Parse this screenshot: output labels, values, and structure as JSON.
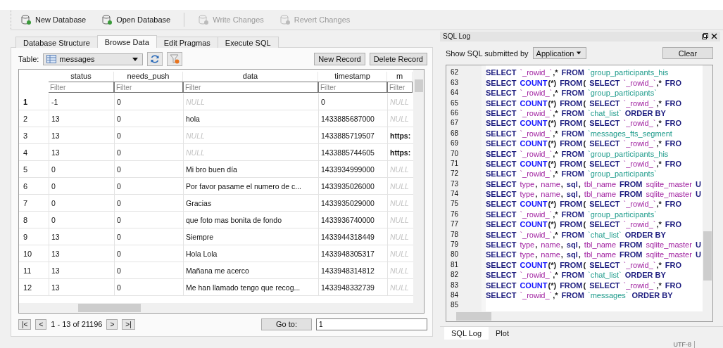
{
  "toolbar": [
    {
      "label": "New Database",
      "disabled": false,
      "kind": "new"
    },
    {
      "label": "Open Database",
      "disabled": false,
      "kind": "open"
    },
    {
      "label": "Write Changes",
      "disabled": true,
      "kind": "write"
    },
    {
      "label": "Revert Changes",
      "disabled": true,
      "kind": "revert"
    }
  ],
  "tabs": [
    {
      "label": "Database Structure",
      "selected": false
    },
    {
      "label": "Browse Data",
      "selected": true
    },
    {
      "label": "Edit Pragmas",
      "selected": false
    },
    {
      "label": "Execute SQL",
      "selected": false
    }
  ],
  "browse": {
    "table_label": "Table:",
    "table": "messages",
    "buttons": [
      "New Record",
      "Delete Record"
    ],
    "columns": [
      {
        "name": "status",
        "filter_placeholder": "Filter"
      },
      {
        "name": "needs_push",
        "filter_placeholder": "Filter"
      },
      {
        "name": "data",
        "filter_placeholder": "Filter"
      },
      {
        "name": "timestamp",
        "filter_placeholder": "Filter"
      },
      {
        "name": "m",
        "filter_placeholder": "Filter"
      }
    ],
    "rows": [
      {
        "number": "1",
        "current": true,
        "cells": [
          {
            "text": "-1",
            "null": false
          },
          {
            "text": "0",
            "null": false
          },
          {
            "text": "NULL",
            "null": true
          },
          {
            "text": "0",
            "null": false
          },
          {
            "text": "NULL",
            "null": true
          }
        ]
      },
      {
        "number": "2",
        "current": false,
        "cells": [
          {
            "text": "13",
            "null": false
          },
          {
            "text": "0",
            "null": false
          },
          {
            "text": "hola",
            "null": false
          },
          {
            "text": "1433885687000",
            "null": false
          },
          {
            "text": "NULL",
            "null": true
          }
        ]
      },
      {
        "number": "3",
        "current": false,
        "cells": [
          {
            "text": "13",
            "null": false
          },
          {
            "text": "0",
            "null": false
          },
          {
            "text": "NULL",
            "null": true
          },
          {
            "text": "1433885719507",
            "null": false
          },
          {
            "text": "https:",
            "null": false
          }
        ]
      },
      {
        "number": "4",
        "current": false,
        "cells": [
          {
            "text": "13",
            "null": false
          },
          {
            "text": "0",
            "null": false
          },
          {
            "text": "NULL",
            "null": true
          },
          {
            "text": "1433885744605",
            "null": false
          },
          {
            "text": "https:",
            "null": false
          }
        ]
      },
      {
        "number": "5",
        "current": false,
        "cells": [
          {
            "text": "0",
            "null": false
          },
          {
            "text": "0",
            "null": false
          },
          {
            "text": "Mi bro buen día",
            "null": false
          },
          {
            "text": "1433934999000",
            "null": false
          },
          {
            "text": "NULL",
            "null": true
          }
        ]
      },
      {
        "number": "6",
        "current": false,
        "cells": [
          {
            "text": "0",
            "null": false
          },
          {
            "text": "0",
            "null": false
          },
          {
            "text": "Por favor pasame el numero de c...",
            "null": false
          },
          {
            "text": "1433935026000",
            "null": false
          },
          {
            "text": "NULL",
            "null": true
          }
        ]
      },
      {
        "number": "7",
        "current": false,
        "cells": [
          {
            "text": "0",
            "null": false
          },
          {
            "text": "0",
            "null": false
          },
          {
            "text": "Gracias",
            "null": false
          },
          {
            "text": "1433935029000",
            "null": false
          },
          {
            "text": "NULL",
            "null": true
          }
        ]
      },
      {
        "number": "8",
        "current": false,
        "cells": [
          {
            "text": "0",
            "null": false
          },
          {
            "text": "0",
            "null": false
          },
          {
            "text": "que foto mas bonita de fondo",
            "null": false
          },
          {
            "text": "1433936740000",
            "null": false
          },
          {
            "text": "NULL",
            "null": true
          }
        ]
      },
      {
        "number": "9",
        "current": false,
        "cells": [
          {
            "text": "13",
            "null": false
          },
          {
            "text": "0",
            "null": false
          },
          {
            "text": "Siempre",
            "null": false
          },
          {
            "text": "1433944318449",
            "null": false
          },
          {
            "text": "NULL",
            "null": true
          }
        ]
      },
      {
        "number": "10",
        "current": false,
        "cells": [
          {
            "text": "13",
            "null": false
          },
          {
            "text": "0",
            "null": false
          },
          {
            "text": "Hola Lola",
            "null": false
          },
          {
            "text": "1433948305317",
            "null": false
          },
          {
            "text": "NULL",
            "null": true
          }
        ]
      },
      {
        "number": "11",
        "current": false,
        "cells": [
          {
            "text": "13",
            "null": false
          },
          {
            "text": "0",
            "null": false
          },
          {
            "text": "Mañana me acerco",
            "null": false
          },
          {
            "text": "1433948314812",
            "null": false
          },
          {
            "text": "NULL",
            "null": true
          }
        ]
      },
      {
        "number": "12",
        "current": false,
        "cells": [
          {
            "text": "13",
            "null": false
          },
          {
            "text": "0",
            "null": false
          },
          {
            "text": "Me han llamado tengo que recog...",
            "null": false
          },
          {
            "text": "1433948332739",
            "null": false
          },
          {
            "text": "NULL",
            "null": true
          }
        ]
      }
    ],
    "pager": {
      "first": "|<",
      "prev": "<",
      "range": "1 - 13 of 21196",
      "next": ">",
      "last": ">|",
      "goto_label": "Go to:",
      "goto_value": "1"
    }
  },
  "sql_log": {
    "title": "SQL Log",
    "filter_label": "Show SQL submitted by",
    "filter_value": "Application",
    "clear": "Clear",
    "lines": [
      {
        "number": "62",
        "tokens": [
          {
            "kind": "k",
            "text": "SELECT"
          },
          {
            "kind": "i",
            "text": "`_rowid_`"
          },
          {
            "kind": "p",
            "text": ",*"
          },
          {
            "kind": "k",
            "text": "FROM"
          },
          {
            "kind": "t",
            "text": "`group_participants_his"
          }
        ]
      },
      {
        "number": "63",
        "tokens": [
          {
            "kind": "k",
            "text": "SELECT"
          },
          {
            "kind": "f",
            "text": "COUNT"
          },
          {
            "kind": "p",
            "text": "(*)"
          },
          {
            "kind": "k",
            "text": "FROM"
          },
          {
            "kind": "p",
            "text": "("
          },
          {
            "kind": "k",
            "text": "SELECT"
          },
          {
            "kind": "i",
            "text": "`_rowid_`"
          },
          {
            "kind": "p",
            "text": ",*"
          },
          {
            "kind": "k",
            "text": "FRO"
          }
        ]
      },
      {
        "number": "64",
        "tokens": [
          {
            "kind": "k",
            "text": "SELECT"
          },
          {
            "kind": "i",
            "text": "`_rowid_`"
          },
          {
            "kind": "p",
            "text": ",*"
          },
          {
            "kind": "k",
            "text": "FROM"
          },
          {
            "kind": "t",
            "text": "`group_participants`"
          }
        ]
      },
      {
        "number": "65",
        "tokens": [
          {
            "kind": "k",
            "text": "SELECT"
          },
          {
            "kind": "f",
            "text": "COUNT"
          },
          {
            "kind": "p",
            "text": "(*)"
          },
          {
            "kind": "k",
            "text": "FROM"
          },
          {
            "kind": "p",
            "text": "("
          },
          {
            "kind": "k",
            "text": "SELECT"
          },
          {
            "kind": "i",
            "text": "`_rowid_`"
          },
          {
            "kind": "p",
            "text": ",*"
          },
          {
            "kind": "k",
            "text": "FRO"
          }
        ]
      },
      {
        "number": "66",
        "tokens": [
          {
            "kind": "k",
            "text": "SELECT"
          },
          {
            "kind": "i",
            "text": "`_rowid_`"
          },
          {
            "kind": "p",
            "text": ",*"
          },
          {
            "kind": "k",
            "text": "FROM"
          },
          {
            "kind": "t",
            "text": "`chat_list`"
          },
          {
            "kind": "k",
            "text": "ORDER BY"
          }
        ]
      },
      {
        "number": "67",
        "tokens": [
          {
            "kind": "k",
            "text": "SELECT"
          },
          {
            "kind": "f",
            "text": "COUNT"
          },
          {
            "kind": "p",
            "text": "(*)"
          },
          {
            "kind": "k",
            "text": "FROM"
          },
          {
            "kind": "p",
            "text": "("
          },
          {
            "kind": "k",
            "text": "SELECT"
          },
          {
            "kind": "i",
            "text": "`_rowid_`"
          },
          {
            "kind": "p",
            "text": ",*"
          },
          {
            "kind": "k",
            "text": "FRO"
          }
        ]
      },
      {
        "number": "68",
        "tokens": [
          {
            "kind": "k",
            "text": "SELECT"
          },
          {
            "kind": "i",
            "text": "`_rowid_`"
          },
          {
            "kind": "p",
            "text": ",*"
          },
          {
            "kind": "k",
            "text": "FROM"
          },
          {
            "kind": "t",
            "text": "`messages_fts_segment"
          }
        ]
      },
      {
        "number": "69",
        "tokens": [
          {
            "kind": "k",
            "text": "SELECT"
          },
          {
            "kind": "f",
            "text": "COUNT"
          },
          {
            "kind": "p",
            "text": "(*)"
          },
          {
            "kind": "k",
            "text": "FROM"
          },
          {
            "kind": "p",
            "text": "("
          },
          {
            "kind": "k",
            "text": "SELECT"
          },
          {
            "kind": "i",
            "text": "`_rowid_`"
          },
          {
            "kind": "p",
            "text": ",*"
          },
          {
            "kind": "k",
            "text": "FRO"
          }
        ]
      },
      {
        "number": "70",
        "tokens": [
          {
            "kind": "k",
            "text": "SELECT"
          },
          {
            "kind": "i",
            "text": "`_rowid_`"
          },
          {
            "kind": "p",
            "text": ",*"
          },
          {
            "kind": "k",
            "text": "FROM"
          },
          {
            "kind": "t",
            "text": "`group_participants_his"
          }
        ]
      },
      {
        "number": "71",
        "tokens": [
          {
            "kind": "k",
            "text": "SELECT"
          },
          {
            "kind": "f",
            "text": "COUNT"
          },
          {
            "kind": "p",
            "text": "(*)"
          },
          {
            "kind": "k",
            "text": "FROM"
          },
          {
            "kind": "p",
            "text": "("
          },
          {
            "kind": "k",
            "text": "SELECT"
          },
          {
            "kind": "i",
            "text": "`_rowid_`"
          },
          {
            "kind": "p",
            "text": ",*"
          },
          {
            "kind": "k",
            "text": "FRO"
          }
        ]
      },
      {
        "number": "72",
        "tokens": [
          {
            "kind": "k",
            "text": "SELECT"
          },
          {
            "kind": "i",
            "text": "`_rowid_`"
          },
          {
            "kind": "p",
            "text": ",*"
          },
          {
            "kind": "k",
            "text": "FROM"
          },
          {
            "kind": "t",
            "text": "`group_participants`"
          }
        ]
      },
      {
        "number": "73",
        "tokens": [
          {
            "kind": "k",
            "text": "SELECT"
          },
          {
            "kind": "i",
            "text": "type"
          },
          {
            "kind": "p",
            "text": ","
          },
          {
            "kind": "i",
            "text": "name"
          },
          {
            "kind": "p",
            "text": ","
          },
          {
            "kind": "k",
            "text": "sql"
          },
          {
            "kind": "p",
            "text": ","
          },
          {
            "kind": "i",
            "text": "tbl_name"
          },
          {
            "kind": "k",
            "text": "FROM"
          },
          {
            "kind": "i",
            "text": "sqlite_master"
          },
          {
            "kind": "k",
            "text": "U"
          }
        ]
      },
      {
        "number": "74",
        "tokens": [
          {
            "kind": "k",
            "text": "SELECT"
          },
          {
            "kind": "i",
            "text": "type"
          },
          {
            "kind": "p",
            "text": ","
          },
          {
            "kind": "i",
            "text": "name"
          },
          {
            "kind": "p",
            "text": ","
          },
          {
            "kind": "k",
            "text": "sql"
          },
          {
            "kind": "p",
            "text": ","
          },
          {
            "kind": "i",
            "text": "tbl_name"
          },
          {
            "kind": "k",
            "text": "FROM"
          },
          {
            "kind": "i",
            "text": "sqlite_master"
          },
          {
            "kind": "k",
            "text": "U"
          }
        ]
      },
      {
        "number": "75",
        "tokens": [
          {
            "kind": "k",
            "text": "SELECT"
          },
          {
            "kind": "f",
            "text": "COUNT"
          },
          {
            "kind": "p",
            "text": "(*)"
          },
          {
            "kind": "k",
            "text": "FROM"
          },
          {
            "kind": "p",
            "text": "("
          },
          {
            "kind": "k",
            "text": "SELECT"
          },
          {
            "kind": "i",
            "text": "`_rowid_`"
          },
          {
            "kind": "p",
            "text": ",*"
          },
          {
            "kind": "k",
            "text": "FRO"
          }
        ]
      },
      {
        "number": "76",
        "tokens": [
          {
            "kind": "k",
            "text": "SELECT"
          },
          {
            "kind": "i",
            "text": "`_rowid_`"
          },
          {
            "kind": "p",
            "text": ",*"
          },
          {
            "kind": "k",
            "text": "FROM"
          },
          {
            "kind": "t",
            "text": "`group_participants`"
          }
        ]
      },
      {
        "number": "77",
        "tokens": [
          {
            "kind": "k",
            "text": "SELECT"
          },
          {
            "kind": "f",
            "text": "COUNT"
          },
          {
            "kind": "p",
            "text": "(*)"
          },
          {
            "kind": "k",
            "text": "FROM"
          },
          {
            "kind": "p",
            "text": "("
          },
          {
            "kind": "k",
            "text": "SELECT"
          },
          {
            "kind": "i",
            "text": "`_rowid_`"
          },
          {
            "kind": "p",
            "text": ",*"
          },
          {
            "kind": "k",
            "text": "FRO"
          }
        ]
      },
      {
        "number": "78",
        "tokens": [
          {
            "kind": "k",
            "text": "SELECT"
          },
          {
            "kind": "i",
            "text": "`_rowid_`"
          },
          {
            "kind": "p",
            "text": ",*"
          },
          {
            "kind": "k",
            "text": "FROM"
          },
          {
            "kind": "t",
            "text": "`chat_list`"
          },
          {
            "kind": "k",
            "text": "ORDER BY"
          }
        ]
      },
      {
        "number": "79",
        "tokens": [
          {
            "kind": "k",
            "text": "SELECT"
          },
          {
            "kind": "i",
            "text": "type"
          },
          {
            "kind": "p",
            "text": ","
          },
          {
            "kind": "i",
            "text": "name"
          },
          {
            "kind": "p",
            "text": ","
          },
          {
            "kind": "k",
            "text": "sql"
          },
          {
            "kind": "p",
            "text": ","
          },
          {
            "kind": "i",
            "text": "tbl_name"
          },
          {
            "kind": "k",
            "text": "FROM"
          },
          {
            "kind": "i",
            "text": "sqlite_master"
          },
          {
            "kind": "k",
            "text": "U"
          }
        ]
      },
      {
        "number": "80",
        "tokens": [
          {
            "kind": "k",
            "text": "SELECT"
          },
          {
            "kind": "i",
            "text": "type"
          },
          {
            "kind": "p",
            "text": ","
          },
          {
            "kind": "i",
            "text": "name"
          },
          {
            "kind": "p",
            "text": ","
          },
          {
            "kind": "k",
            "text": "sql"
          },
          {
            "kind": "p",
            "text": ","
          },
          {
            "kind": "i",
            "text": "tbl_name"
          },
          {
            "kind": "k",
            "text": "FROM"
          },
          {
            "kind": "i",
            "text": "sqlite_master"
          },
          {
            "kind": "k",
            "text": "U"
          }
        ]
      },
      {
        "number": "81",
        "tokens": [
          {
            "kind": "k",
            "text": "SELECT"
          },
          {
            "kind": "f",
            "text": "COUNT"
          },
          {
            "kind": "p",
            "text": "(*)"
          },
          {
            "kind": "k",
            "text": "FROM"
          },
          {
            "kind": "p",
            "text": "("
          },
          {
            "kind": "k",
            "text": "SELECT"
          },
          {
            "kind": "i",
            "text": "`_rowid_`"
          },
          {
            "kind": "p",
            "text": ",*"
          },
          {
            "kind": "k",
            "text": "FRO"
          }
        ]
      },
      {
        "number": "82",
        "tokens": [
          {
            "kind": "k",
            "text": "SELECT"
          },
          {
            "kind": "i",
            "text": "`_rowid_`"
          },
          {
            "kind": "p",
            "text": ",*"
          },
          {
            "kind": "k",
            "text": "FROM"
          },
          {
            "kind": "t",
            "text": "`chat_list`"
          },
          {
            "kind": "k",
            "text": "ORDER BY"
          }
        ]
      },
      {
        "number": "83",
        "tokens": [
          {
            "kind": "k",
            "text": "SELECT"
          },
          {
            "kind": "f",
            "text": "COUNT"
          },
          {
            "kind": "p",
            "text": "(*)"
          },
          {
            "kind": "k",
            "text": "FROM"
          },
          {
            "kind": "p",
            "text": "("
          },
          {
            "kind": "k",
            "text": "SELECT"
          },
          {
            "kind": "i",
            "text": "`_rowid_`"
          },
          {
            "kind": "p",
            "text": ",*"
          },
          {
            "kind": "k",
            "text": "FRO"
          }
        ]
      },
      {
        "number": "84",
        "tokens": [
          {
            "kind": "k",
            "text": "SELECT"
          },
          {
            "kind": "i",
            "text": "`_rowid_`"
          },
          {
            "kind": "p",
            "text": ",*"
          },
          {
            "kind": "k",
            "text": "FROM"
          },
          {
            "kind": "t",
            "text": "`messages`"
          },
          {
            "kind": "k",
            "text": "ORDER BY"
          }
        ]
      },
      {
        "number": "85"
      }
    ]
  },
  "bottom_tabs": [
    {
      "label": "SQL Log",
      "selected": true
    },
    {
      "label": "Plot",
      "selected": false
    }
  ],
  "status_bar": {
    "encoding": "UTF-8"
  }
}
